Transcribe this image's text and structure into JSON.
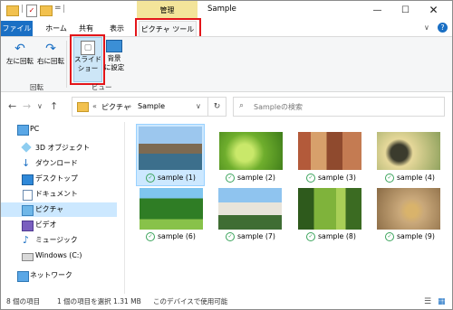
{
  "window": {
    "title": "Sample",
    "context_tab_header": "管理"
  },
  "tabs": {
    "file": "ファイル",
    "home": "ホーム",
    "share": "共有",
    "view": "表示",
    "picture_tools": "ピクチャ ツール"
  },
  "ribbon": {
    "rotate_left": "左に回転",
    "rotate_right": "右に回転",
    "slideshow_line1": "スライド",
    "slideshow_line2": "ショー",
    "set_bg_line1": "背景",
    "set_bg_line2": "に設定",
    "group_rotate": "回転",
    "group_view": "ビュー"
  },
  "address": {
    "crumbs": [
      "«",
      "ピクチャ",
      "›",
      "Sample"
    ],
    "search_placeholder": "Sampleの検索"
  },
  "nav_items": [
    {
      "label": "PC",
      "icon": "pc-icon",
      "selected": false
    },
    {
      "label": "3D オブジェクト",
      "icon": "3d-objects-icon",
      "selected": false
    },
    {
      "label": "ダウンロード",
      "icon": "download-icon",
      "selected": false
    },
    {
      "label": "デスクトップ",
      "icon": "desktop-icon",
      "selected": false
    },
    {
      "label": "ドキュメント",
      "icon": "documents-icon",
      "selected": false
    },
    {
      "label": "ピクチャ",
      "icon": "pictures-icon",
      "selected": true
    },
    {
      "label": "ビデオ",
      "icon": "videos-icon",
      "selected": false
    },
    {
      "label": "ミュージック",
      "icon": "music-icon",
      "selected": false
    },
    {
      "label": "Windows (C:)",
      "icon": "drive-icon",
      "selected": false
    },
    {
      "label": "ネットワーク",
      "icon": "network-icon",
      "selected": false
    }
  ],
  "files": [
    {
      "name": "sample (1)",
      "scene": "town-canal",
      "selected": true
    },
    {
      "name": "sample (2)",
      "scene": "green-leaves",
      "selected": false
    },
    {
      "name": "sample (3)",
      "scene": "canal-houses",
      "selected": false
    },
    {
      "name": "sample (4)",
      "scene": "ducklings",
      "selected": false
    },
    {
      "name": "sample (6)",
      "scene": "park-trees",
      "selected": false
    },
    {
      "name": "sample (7)",
      "scene": "castle",
      "selected": false
    },
    {
      "name": "sample (8)",
      "scene": "forest-path",
      "selected": false
    },
    {
      "name": "sample (9)",
      "scene": "snail",
      "selected": false
    }
  ],
  "status": {
    "item_count": "8 個の項目",
    "selected": "1 個の項目を選択  1.31 MB",
    "availability": "このデバイスで使用可能"
  },
  "colors": {
    "accent": "#1a6fc4",
    "highlight_box": "#e3151a",
    "context_tab": "#f3e49a",
    "selection": "#cce8ff"
  }
}
